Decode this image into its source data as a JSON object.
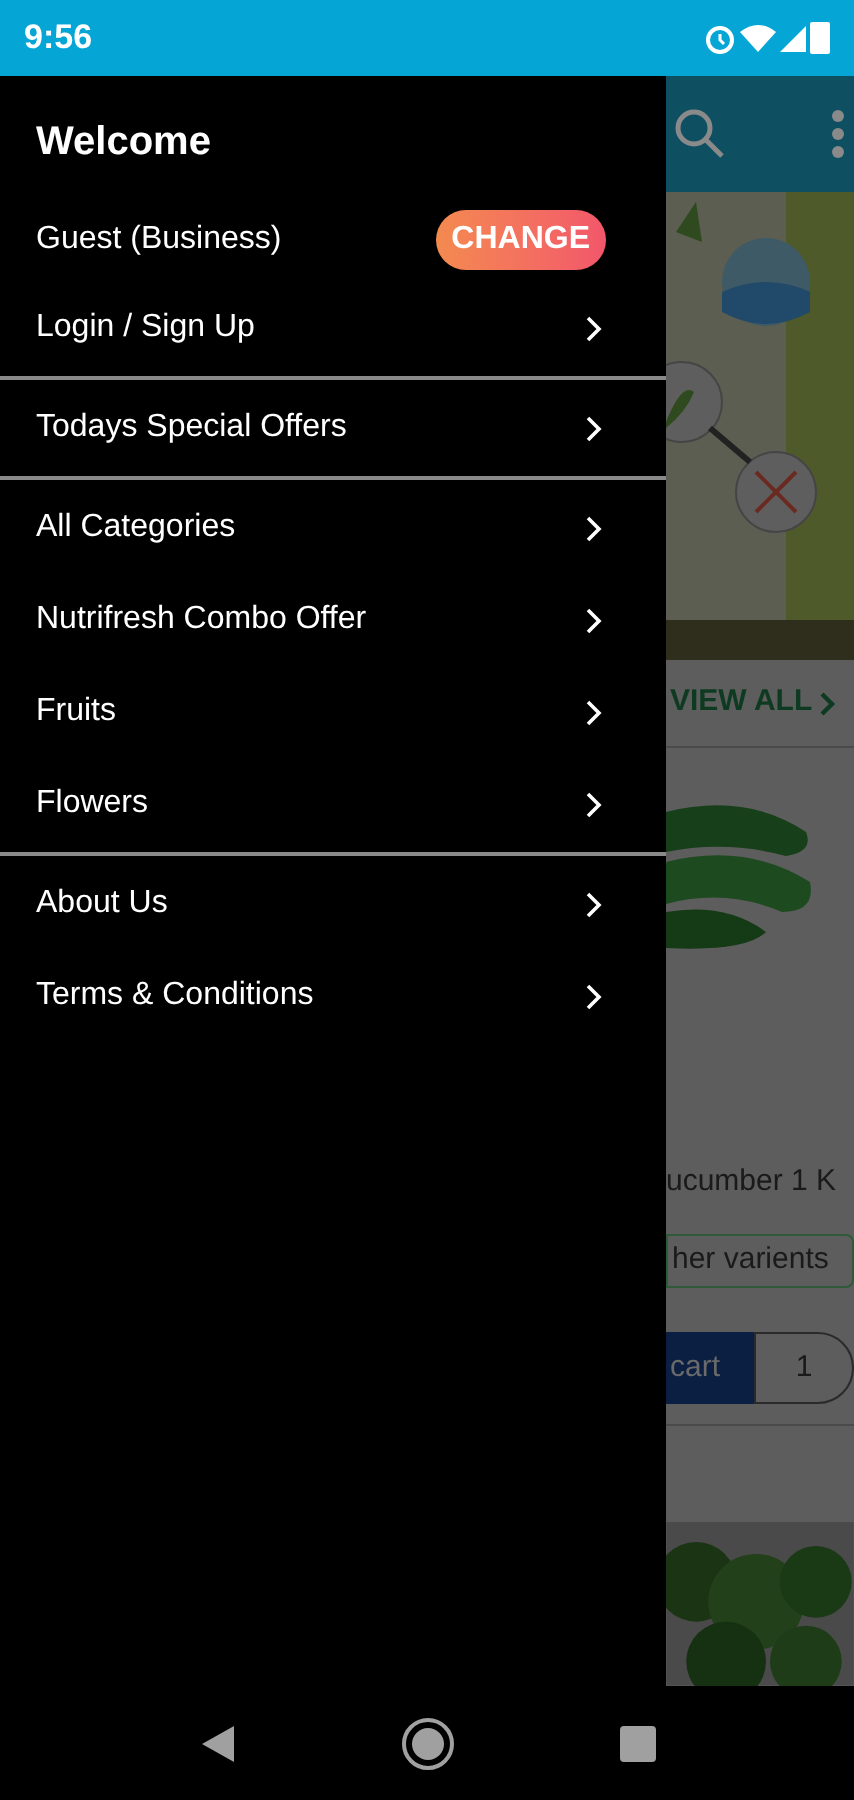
{
  "status_bar": {
    "time": "9:56"
  },
  "drawer": {
    "title": "Welcome",
    "user": {
      "label": "Guest (Business)",
      "button": "CHANGE"
    },
    "sections": [
      {
        "items": [
          {
            "label": "Login / Sign Up"
          }
        ]
      },
      {
        "items": [
          {
            "label": "Todays Special Offers"
          }
        ]
      },
      {
        "items": [
          {
            "label": "All Categories"
          },
          {
            "label": "Nutrifresh Combo Offer"
          },
          {
            "label": "Fruits"
          },
          {
            "label": "Flowers"
          }
        ]
      },
      {
        "items": [
          {
            "label": "About Us"
          },
          {
            "label": "Terms & Conditions"
          }
        ]
      }
    ]
  },
  "background": {
    "view_all": "VIEW ALL",
    "product_name": "ucumber 1 K",
    "variants": "her varients",
    "cart_button": "cart",
    "quantity": "1"
  }
}
